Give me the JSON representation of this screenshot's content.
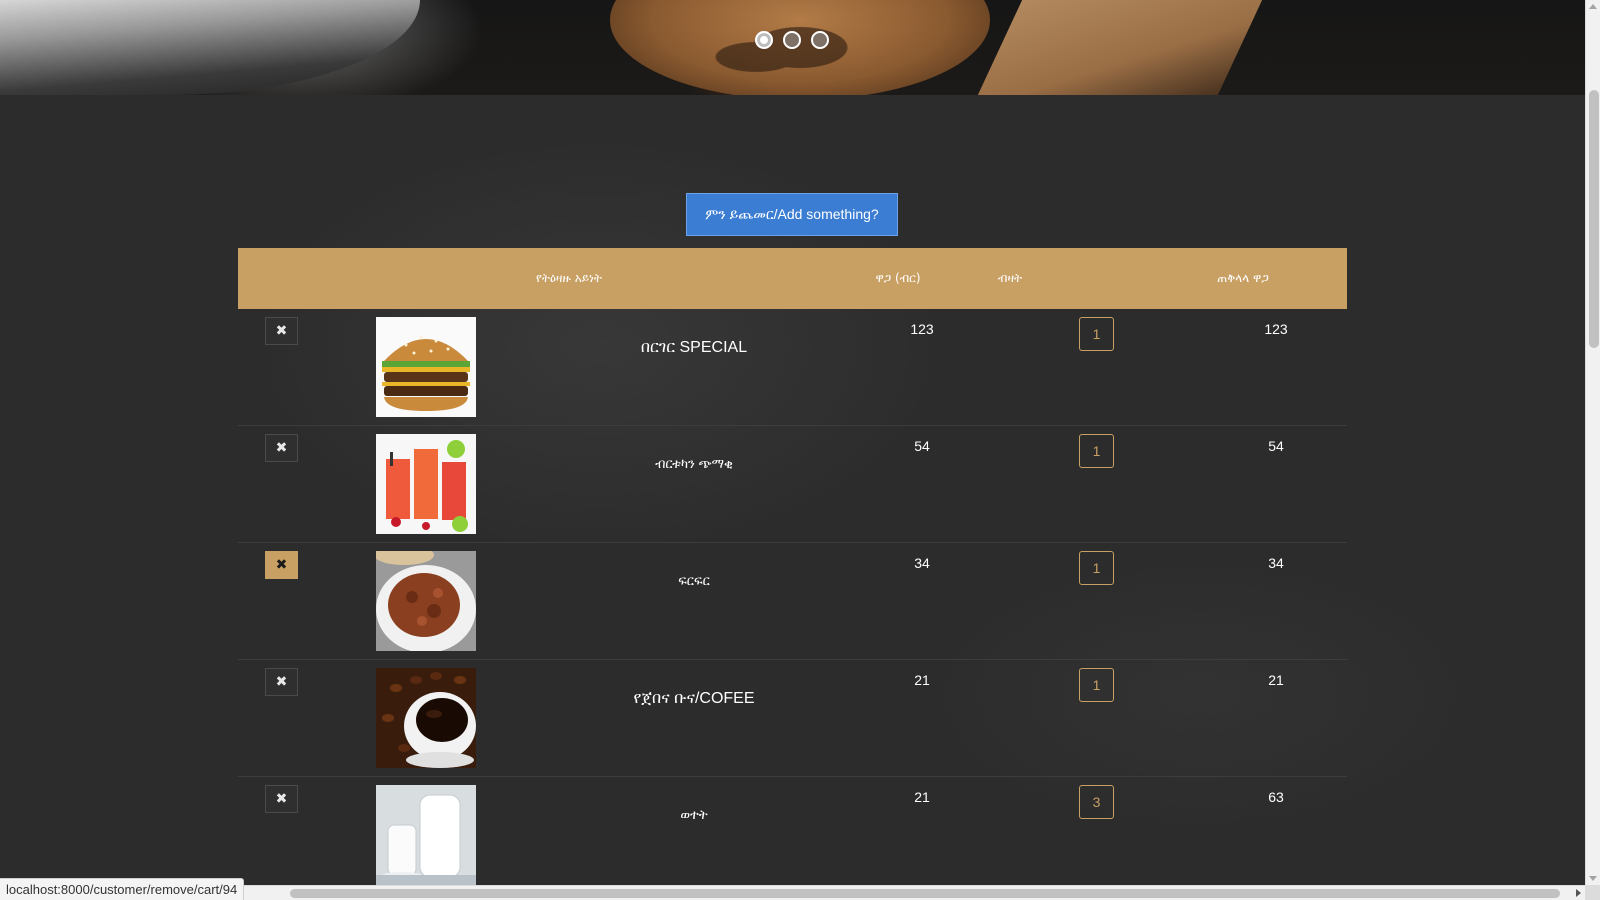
{
  "hero": {
    "dots": [
      {
        "state": "active"
      },
      {
        "state": "inactive"
      },
      {
        "state": "inactive"
      }
    ]
  },
  "actions": {
    "add_label": "ምን ይጨመር/Add something?"
  },
  "table": {
    "headers": {
      "item_type": "የትዕዛዙ አይነት",
      "price": "ዋጋ (ብር)",
      "quantity": "ብዛት",
      "total": "ጠቅላላ ዋጋ"
    },
    "rows": [
      {
        "name": "በርገር SPECIAL",
        "price": "123",
        "quantity": "1",
        "total": "123",
        "image": "burger",
        "remove_icon": "✖"
      },
      {
        "name": "ብርቱካን ጭማቂ",
        "price": "54",
        "quantity": "1",
        "total": "54",
        "image": "juice",
        "remove_icon": "✖"
      },
      {
        "name": "ፍርፍር",
        "price": "34",
        "quantity": "1",
        "total": "34",
        "image": "firfir",
        "remove_icon": "✖"
      },
      {
        "name": "የጀበና ቡና/COFEE",
        "price": "21",
        "quantity": "1",
        "total": "21",
        "image": "coffee",
        "remove_icon": "✖"
      },
      {
        "name": "ወተት",
        "price": "21",
        "quantity": "3",
        "total": "63",
        "image": "milk",
        "remove_icon": "✖"
      }
    ]
  },
  "status_bar": {
    "url": "localhost:8000/customer/remove/cart/94"
  },
  "colors": {
    "accent_gold": "#c9a063",
    "button_blue": "#3a7dd3",
    "board": "#2c2c2c"
  }
}
